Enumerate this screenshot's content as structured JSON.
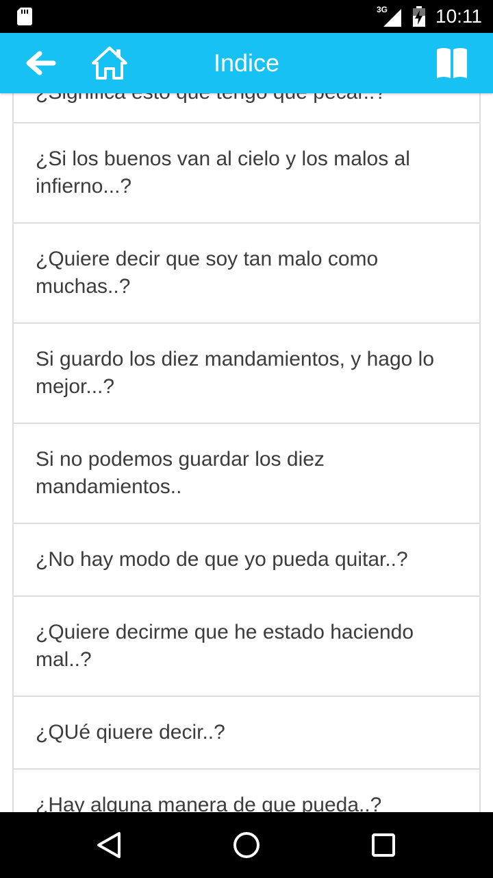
{
  "status_bar": {
    "network": "3G",
    "time": "10:11"
  },
  "app_bar": {
    "title": "Indice",
    "back_icon": "arrow-left-icon",
    "home_icon": "home-icon",
    "book_icon": "book-icon"
  },
  "list": {
    "items": [
      {
        "label": "¿Significa esto que tengo que pecar..?"
      },
      {
        "label": "¿Si los buenos van al cielo y los malos al infierno...?"
      },
      {
        "label": "¿Quiere decir que soy tan malo como muchas..?"
      },
      {
        "label": "Si guardo los diez mandamientos, y hago lo mejor...?"
      },
      {
        "label": "Si no podemos guardar los diez mandamientos.."
      },
      {
        "label": "¿No hay modo de que yo pueda quitar..?"
      },
      {
        "label": "¿Quiere decirme que he estado haciendo mal..?"
      },
      {
        "label": "¿QUé qiuere decir..?"
      },
      {
        "label": "¿Hay alguna manera de que pueda..?"
      }
    ]
  },
  "nav_bar": {
    "back": "triangle-back-icon",
    "home": "circle-home-icon",
    "recents": "square-recents-icon"
  }
}
